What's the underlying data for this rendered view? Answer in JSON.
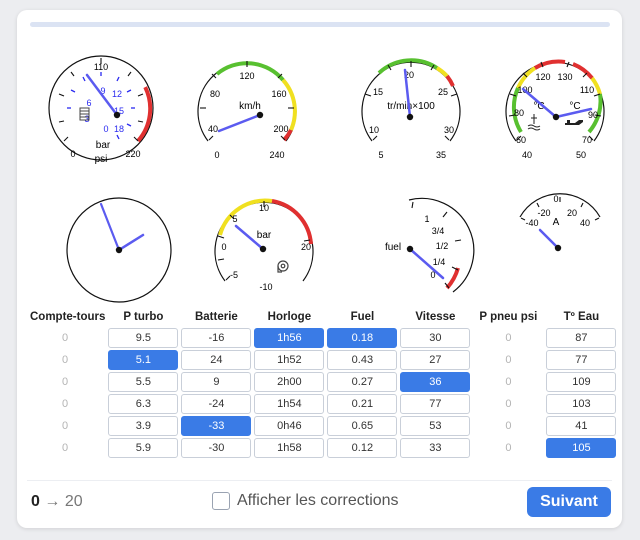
{
  "progress": {
    "fraction": 0.0
  },
  "gauges": {
    "turbo_psi": {
      "outer_ticks": [
        "0",
        "110",
        "220"
      ],
      "inner_ticks": [
        "9",
        "12",
        "6",
        "15",
        "3",
        "0",
        "18"
      ],
      "outer_unit": "psi",
      "inner_unit": "bar",
      "icon": "turbo-icon"
    },
    "speed": {
      "ticks": [
        "40",
        "80",
        "120",
        "160",
        "200",
        "240",
        "0"
      ],
      "unit": "km/h"
    },
    "rpm": {
      "ticks": [
        "5",
        "10",
        "15",
        "20",
        "25",
        "30",
        "35"
      ],
      "unit": "tr/min×100"
    },
    "temp": {
      "outer_ticks": [
        "40",
        "60",
        "80",
        "100",
        "120",
        "130",
        "110",
        "90",
        "70",
        "50"
      ],
      "left_unit": "°C",
      "right_unit": "°C",
      "icons": [
        "coolant-icon",
        "oil-can-icon"
      ]
    },
    "clock": {},
    "boost_bar": {
      "ticks": [
        "-10",
        "-5",
        "0",
        "5",
        "10",
        "20"
      ],
      "unit": "bar",
      "icon": "turbo-icon"
    },
    "fuel": {
      "ticks": [
        "0",
        "1/4",
        "1/2",
        "3/4",
        "1"
      ],
      "unit": "fuel"
    },
    "battery": {
      "ticks": [
        "-40",
        "-20",
        "0",
        "20",
        "40"
      ],
      "unit": "A"
    }
  },
  "table": {
    "headers": [
      "Compte-tours",
      "P turbo",
      "Batterie",
      "Horloge",
      "Fuel",
      "Vitesse",
      "P pneu psi",
      "Tº Eau"
    ],
    "columns": [
      {
        "style": "plain",
        "values": [
          "0",
          "0",
          "0",
          "0",
          "0",
          "0"
        ],
        "selected": -1
      },
      {
        "style": "box",
        "values": [
          "9.5",
          "5.1",
          "5.5",
          "6.3",
          "3.9",
          "5.9"
        ],
        "selected": 1
      },
      {
        "style": "box",
        "values": [
          "-16",
          "24",
          "9",
          "-24",
          "-33",
          "-30"
        ],
        "selected": 4
      },
      {
        "style": "box",
        "values": [
          "1h56",
          "1h52",
          "2h00",
          "1h54",
          "0h46",
          "1h58"
        ],
        "selected": 0
      },
      {
        "style": "box",
        "values": [
          "0.18",
          "0.43",
          "0.27",
          "0.21",
          "0.65",
          "0.12"
        ],
        "selected": 0
      },
      {
        "style": "box",
        "values": [
          "30",
          "27",
          "36",
          "77",
          "53",
          "33"
        ],
        "selected": 2
      },
      {
        "style": "plain",
        "values": [
          "0",
          "0",
          "0",
          "0",
          "0",
          "0"
        ],
        "selected": -1
      },
      {
        "style": "box",
        "values": [
          "87",
          "77",
          "109",
          "103",
          "41",
          "105"
        ],
        "selected": 5
      }
    ]
  },
  "footer": {
    "current": "0",
    "arrow": "→",
    "total": "20",
    "corrections_label": "Afficher les corrections",
    "next_label": "Suivant"
  },
  "colors": {
    "accent": "#3a7be6",
    "needle": "#5b5bf0",
    "red": "#e03030",
    "yellow": "#f0e020",
    "green": "#58c030"
  }
}
